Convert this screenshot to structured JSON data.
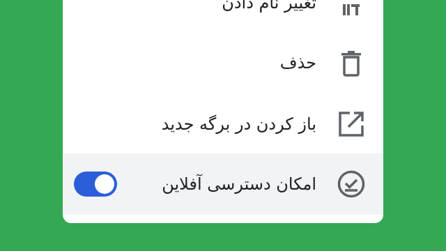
{
  "menu": {
    "items": [
      {
        "label": "تغییر نام دادن",
        "icon": "rename-icon"
      },
      {
        "label": "حذف",
        "icon": "trash-icon"
      },
      {
        "label": "باز کردن در برگه جدید",
        "icon": "open-in-new-icon"
      },
      {
        "label": "امکان دسترسی آفلاین",
        "icon": "offline-check-icon",
        "toggle_on": true
      }
    ]
  },
  "colors": {
    "background": "#34a853",
    "toggle_on": "#2b5fd9",
    "highlight_row": "#f1f3f4",
    "icon": "#5f6368"
  }
}
